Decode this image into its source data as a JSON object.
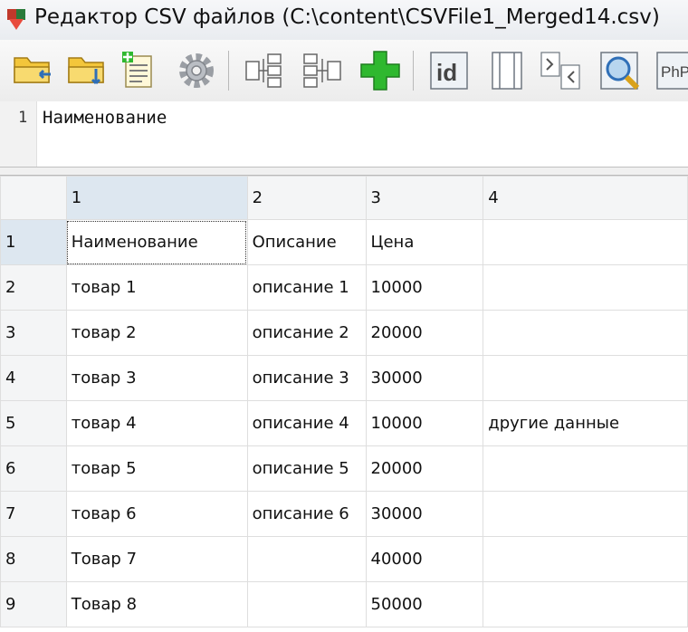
{
  "window": {
    "title": "Редактор CSV файлов (C:\\content\\CSVFile1_Merged14.csv)"
  },
  "toolbar": {
    "buttons": [
      {
        "name": "open-file-icon"
      },
      {
        "name": "save-file-icon"
      },
      {
        "name": "new-file-icon"
      },
      {
        "name": "settings-gear-icon"
      },
      {
        "name": "merge-columns-icon"
      },
      {
        "name": "split-columns-icon"
      },
      {
        "name": "add-row-icon"
      },
      {
        "name": "id-column-icon"
      },
      {
        "name": "column-width-icon"
      },
      {
        "name": "html-tags-icon"
      },
      {
        "name": "search-magnifier-icon"
      },
      {
        "name": "php-icon",
        "label": "PhP"
      }
    ]
  },
  "editor": {
    "line_number": "1",
    "text": "Наименование"
  },
  "grid": {
    "columns": [
      "1",
      "2",
      "3",
      "4"
    ],
    "rows": [
      {
        "num": "1",
        "cells": [
          "Наименование",
          "Описание",
          "Цена",
          ""
        ]
      },
      {
        "num": "2",
        "cells": [
          "товар 1",
          "описание 1",
          "10000",
          ""
        ]
      },
      {
        "num": "3",
        "cells": [
          "товар 2",
          "описание 2",
          "20000",
          ""
        ]
      },
      {
        "num": "4",
        "cells": [
          "товар 3",
          "описание 3",
          "30000",
          ""
        ]
      },
      {
        "num": "5",
        "cells": [
          "товар 4",
          "описание 4",
          "10000",
          "другие данные"
        ]
      },
      {
        "num": "6",
        "cells": [
          "товар 5",
          "описание 5",
          "20000",
          ""
        ]
      },
      {
        "num": "7",
        "cells": [
          "товар 6",
          "описание 6",
          "30000",
          ""
        ]
      },
      {
        "num": "8",
        "cells": [
          "Товар 7",
          "",
          "40000",
          ""
        ]
      },
      {
        "num": "9",
        "cells": [
          "Товар 8",
          "",
          "50000",
          ""
        ]
      }
    ],
    "selected": {
      "row": 1,
      "column": 1
    }
  },
  "colors": {
    "selection_header": "#dde7f0",
    "add_green": "#2fb82f",
    "title_bar": "#e9ecf0"
  }
}
